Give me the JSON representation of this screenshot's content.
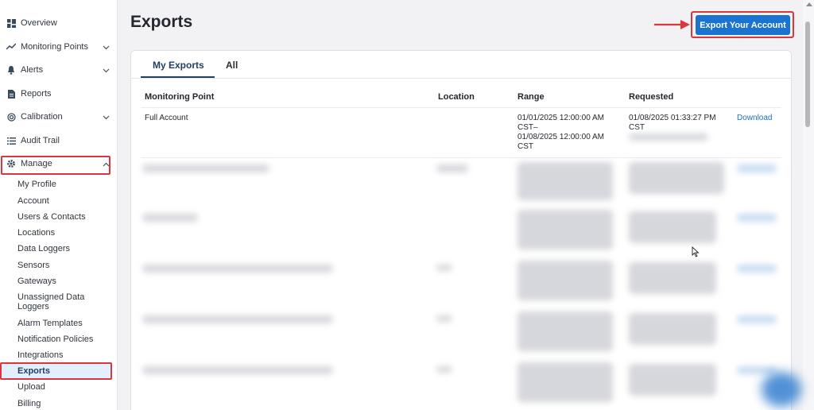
{
  "sidebar": {
    "items": [
      {
        "label": "Overview",
        "icon": "grid-icon"
      },
      {
        "label": "Monitoring Points",
        "icon": "trend-line-icon"
      },
      {
        "label": "Alerts",
        "icon": "bell-icon"
      },
      {
        "label": "Reports",
        "icon": "document-icon"
      },
      {
        "label": "Calibration",
        "icon": "target-icon"
      },
      {
        "label": "Audit Trail",
        "icon": "list-icon"
      },
      {
        "label": "Manage",
        "icon": "gear-icon"
      }
    ],
    "manage_sub": [
      "My Profile",
      "Account",
      "Users & Contacts",
      "Locations",
      "Data Loggers",
      "Sensors",
      "Gateways",
      "Unassigned Data Loggers",
      "Alarm Templates",
      "Notification Policies",
      "Integrations",
      "Exports",
      "Upload",
      "Billing"
    ],
    "active_item": "Exports"
  },
  "page": {
    "title": "Exports",
    "export_button": "Export Your Account"
  },
  "tabs": [
    "My Exports",
    "All"
  ],
  "table": {
    "headers": [
      "Monitoring Point",
      "Location",
      "Range",
      "Requested"
    ],
    "rows": [
      {
        "monitoring_point": "Full Account",
        "location": "",
        "range_line1": "01/01/2025 12:00:00 AM",
        "range_line2": "CST–",
        "range_line3": "01/08/2025 12:00:00 AM",
        "range_line4": "CST",
        "requested_line1": "01/08/2025 01:33:27 PM",
        "requested_line2": "CST",
        "action": "Download"
      }
    ]
  },
  "colors": {
    "accent": "#1a73d0",
    "highlight": "#d9363e",
    "nav_active_bg": "#e3efff",
    "tab_active": "#24405e"
  }
}
